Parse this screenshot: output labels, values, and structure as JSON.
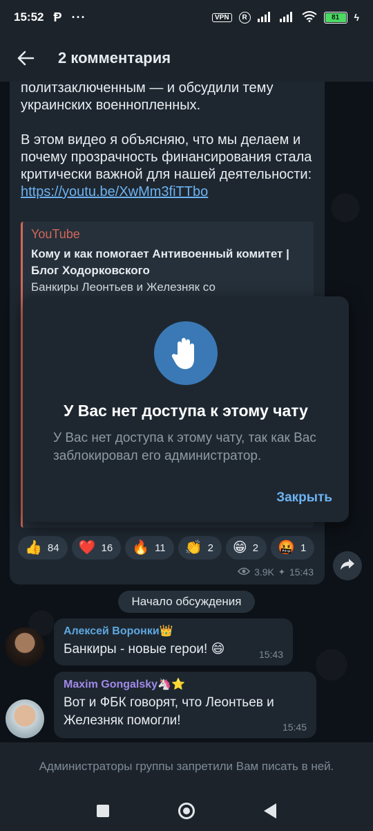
{
  "status_bar": {
    "time": "15:52",
    "vpn": "VPN",
    "r_badge": "R",
    "battery": "81",
    "icons": [
      "parler-icon",
      "more-dots-icon",
      "vpn-icon",
      "r-icon",
      "signal-icon",
      "signal-icon",
      "wifi-icon",
      "battery-icon",
      "charging-icon"
    ]
  },
  "header": {
    "title": "2 комментария",
    "back_icon": "arrow-left-icon"
  },
  "post": {
    "paragraph1": "политзаключенным — и обсудили тему украинских военнопленных.",
    "paragraph2": "В этом видео я объясняю, что мы делаем и почему прозрачность финансирования стала критически важной для нашей деятельности:",
    "link": "https://youtu.be/XwMm3fiTTbo",
    "preview": {
      "source": "YouTube",
      "title": "Кому и как помогает Антивоенный комитет | Блог Ходорковского",
      "description": "Банкиры Леонтьев и Железняк со"
    },
    "reactions": [
      {
        "emoji": "👍",
        "count": "84"
      },
      {
        "emoji": "❤️",
        "count": "16"
      },
      {
        "emoji": "🔥",
        "count": "11"
      },
      {
        "emoji": "👏",
        "count": "2"
      },
      {
        "emoji": "😁",
        "count": "2"
      },
      {
        "emoji": "🤬",
        "count": "1"
      }
    ],
    "views": "3.9K",
    "time": "15:43"
  },
  "discussion_label": "Начало обсуждения",
  "comments": [
    {
      "author": "Алексей Воронки",
      "author_emoji": "👑",
      "text": "Банкиры - новые герои! 😄",
      "time": "15:43"
    },
    {
      "author": "Maxim Gongalsky",
      "author_emoji": "🦄⭐",
      "text": "Вот и ФБК говорят, что Леонтьев и Железняк помогли!",
      "time": "15:45"
    }
  ],
  "modal": {
    "title": "У Вас нет доступа к этому чату",
    "text": "У Вас нет доступа к этому чату, так как Вас заблокировал его администратор.",
    "close_label": "Закрыть"
  },
  "input_bar": {
    "text": "Администраторы группы запретили Вам писать в ней."
  },
  "colors": {
    "accent": "#6db3f2",
    "bubble": "#1e2730",
    "header": "#1c232b",
    "link_preview_bar": "#d2675a",
    "hand_circle": "#3a79b5"
  }
}
